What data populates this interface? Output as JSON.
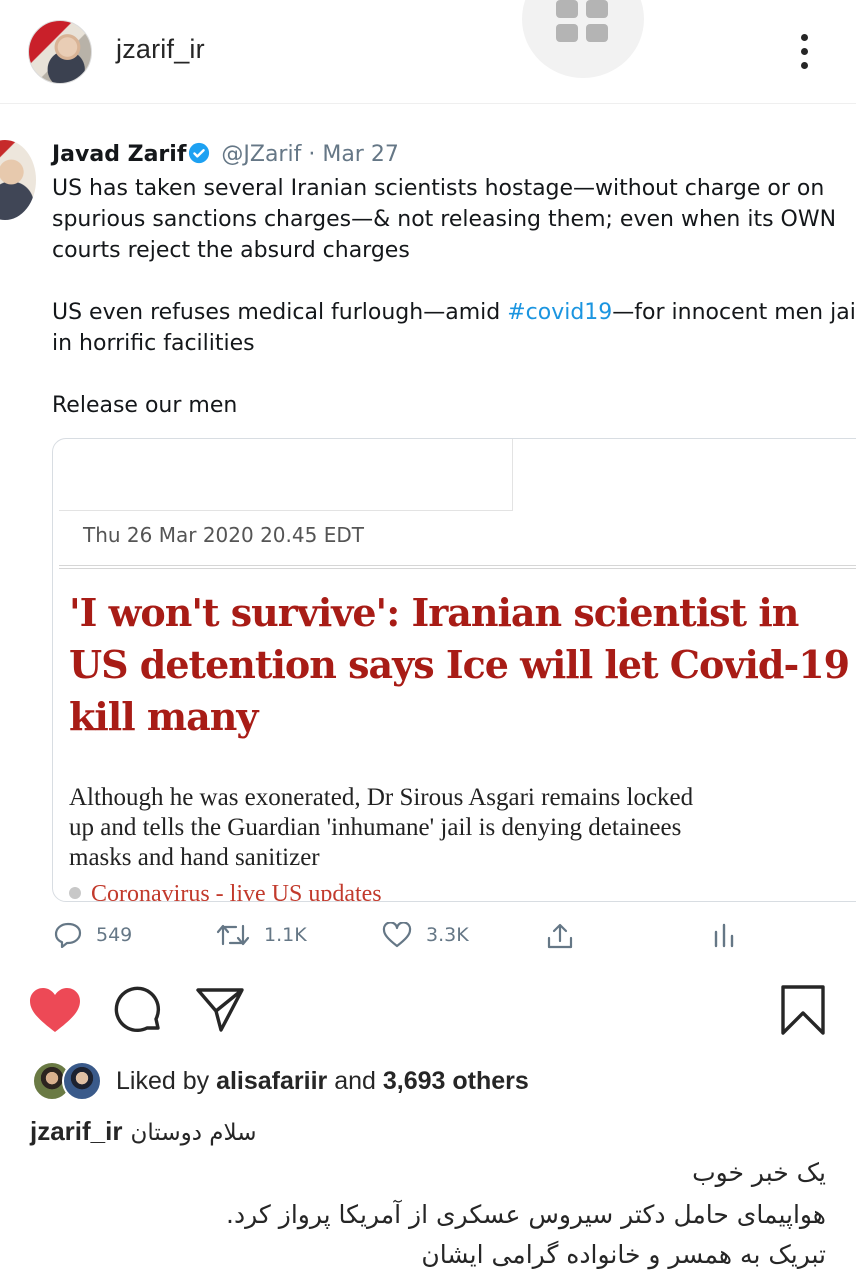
{
  "post": {
    "username": "jzarif_ir",
    "more_icon": "more-vertical-icon"
  },
  "tweet": {
    "name": "Javad Zarif",
    "handle": "@JZarif",
    "separator": "·",
    "date": "Mar 27",
    "lines": {
      "l1": "US has taken several Iranian scientists hostage—without charge or on",
      "l2": "spurious sanctions charges—& not releasing them; even when its OWN",
      "l3": "courts reject the absurd charges",
      "l4a": "US even refuses medical furlough—amid ",
      "l4_hashtag": "#covid19",
      "l4b": "—for innocent men jailed",
      "l5": "in horrific facilities",
      "l6": "Release our men"
    },
    "card": {
      "date": "Thu 26 Mar 2020 20.45 EDT",
      "headline": {
        "l1": "'I won't survive': Iranian scientist in",
        "l2": "US detention says Ice will let Covid-19",
        "l3": "kill many"
      },
      "standfirst": {
        "l1": "Although he was exonerated, Dr Sirous Asgari remains locked",
        "l2": "up and tells the Guardian 'inhumane' jail is denying detainees",
        "l3": "masks and hand sanitizer"
      },
      "kicker": "Coronavirus - live US updates"
    },
    "actions": {
      "replies": "549",
      "retweets": "1.1K",
      "likes": "3.3K"
    },
    "colors": {
      "link": "#1b95e0",
      "headline": "#a81c16",
      "muted": "#657786"
    }
  },
  "engagement": {
    "liked_by_prefix": "Liked by ",
    "liked_by_user": "alisafariir",
    "liked_by_and": " and ",
    "liked_by_others": "3,693 others",
    "heart_color": "#ed4956"
  },
  "caption": {
    "username": "jzarif_ir",
    "greeting": "سلام دوستان",
    "line1": "یک خبر خوب",
    "line2": "هواپیمای حامل دکتر سیروس عسکری از آمریکا پرواز کرد.",
    "line3": "تبریک به همسر و خانواده گرامی ایشان"
  }
}
